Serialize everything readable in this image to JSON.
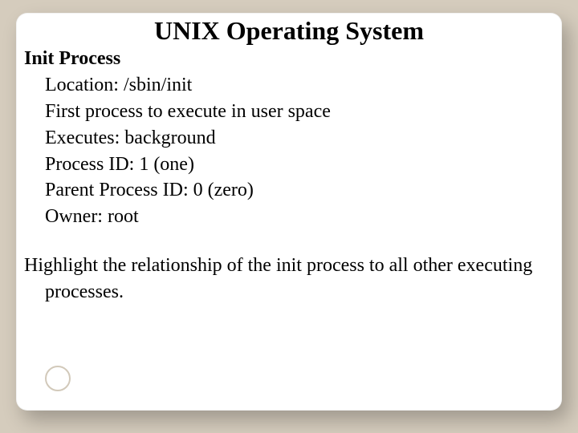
{
  "title": "UNIX Operating System",
  "heading": "Init Process",
  "lines": {
    "l1": "Location:  /sbin/init",
    "l2": "First process to execute in user space",
    "l3": "Executes: background",
    "l4": "Process ID: 1 (one)",
    "l5": "Parent Process ID: 0 (zero)",
    "l6": "Owner: root"
  },
  "paragraph": "Highlight the relationship of the init process to all other executing processes."
}
